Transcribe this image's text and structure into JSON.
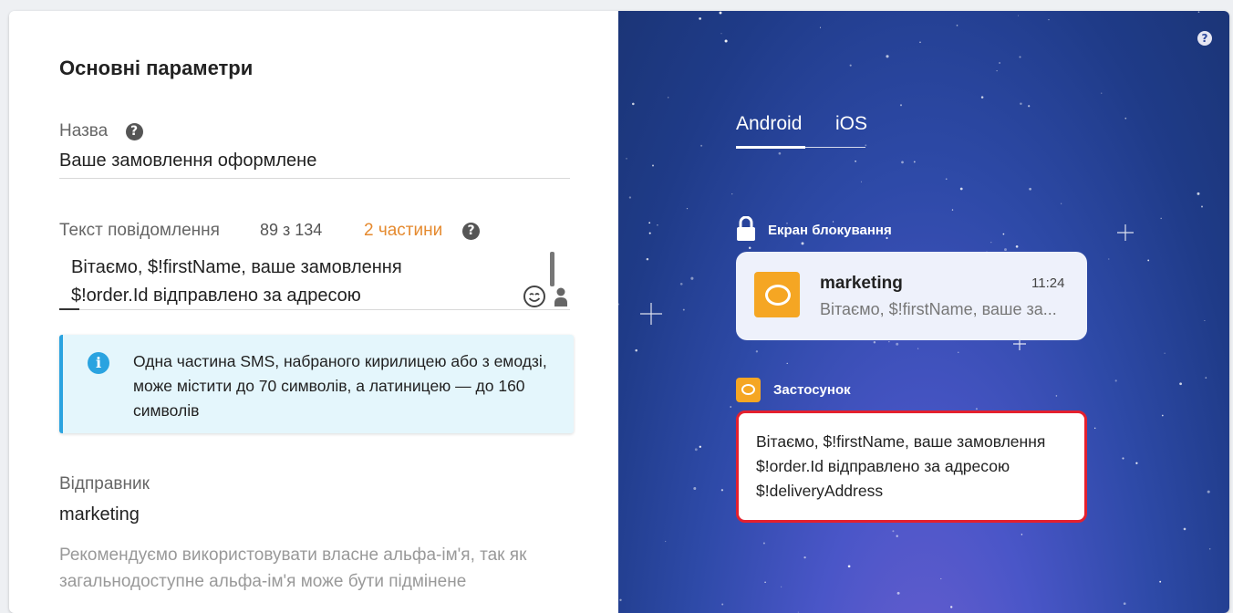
{
  "form": {
    "section_title": "Основні параметри",
    "name_label": "Назва",
    "name_value": "Ваше замовлення оформлене",
    "message_label": "Текст повідомлення",
    "char_count": "89  з 134",
    "parts": "2 частини",
    "message_line1": "Вітаємо, $!firstName, ваше замовлення",
    "message_line2": "$!order.Id відправлено за адресою",
    "info_text": "Одна частина SMS, набраного кирилицею або з емодзі, може містити до 70 символів, а латиницею — до 160 символів",
    "sender_label": "Відправник",
    "sender_value": "marketing",
    "sender_hint": "Рекомендуємо використовувати власне альфа-ім'я, так як загальнодоступне альфа-ім'я може бути підмінене"
  },
  "preview": {
    "tabs": [
      {
        "label": "Android",
        "active": true
      },
      {
        "label": "iOS",
        "active": false
      }
    ],
    "lock_screen_label": "Екран блокування",
    "notification": {
      "sender": "marketing",
      "time": "11:24",
      "text": "Вітаємо, $!firstName, ваше за..."
    },
    "app_label": "Застосунок",
    "app_message": "Вітаємо, $!firstName, ваше замовлення $!order.Id відправлено за адресою $!deliveryAddress"
  },
  "colors": {
    "accent_orange": "#e58a2f",
    "info_blue": "#2aa3e0",
    "app_icon": "#f5a623",
    "highlight_border": "#e4202e"
  },
  "icons": [
    "help-icon",
    "emoji-icon",
    "person-icon",
    "info-icon",
    "lock-icon",
    "chat-bubble-icon"
  ]
}
